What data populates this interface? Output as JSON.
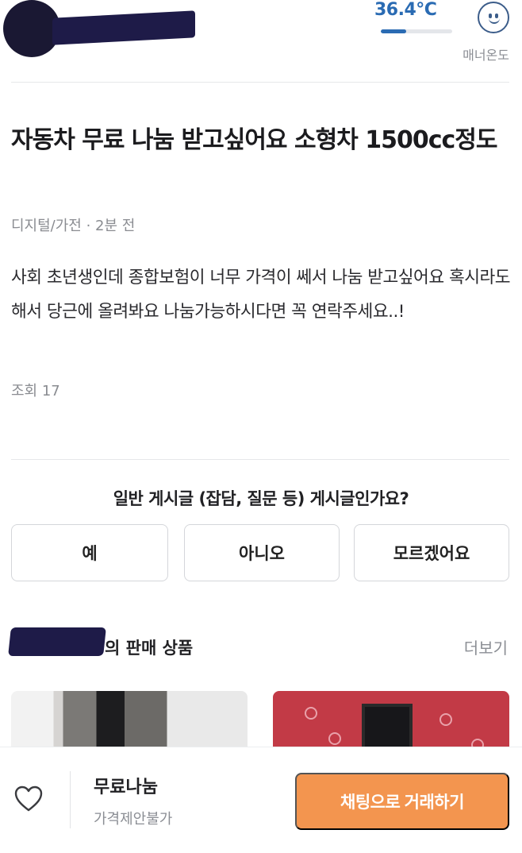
{
  "seller": {
    "manner_temperature": "36.4°C",
    "temperature_level": 0.36,
    "manner_label": "매너온도",
    "face_icon": "smiling-face-icon"
  },
  "post": {
    "title": "자동차 무료 나눔 받고싶어요 소형차 1500cc정도",
    "meta": "디지털/가전 · 2분 전",
    "body": "사회 초년생인데 종합보험이 너무 가격이 쎄서 나눔 받고싶어요 혹시라도 해서 당근에 올려봐요 나눔가능하시다면 꼭 연락주세요..!",
    "views": "조회 17"
  },
  "survey": {
    "question": "일반 게시글 (잡담, 질문 등) 게시글인가요?",
    "answers": [
      "예",
      "아니오",
      "모르겠어요"
    ]
  },
  "seller_products": {
    "heading": "의 판매 상품",
    "more": "더보기"
  },
  "bottom_bar": {
    "heart_icon": "heart-outline-icon",
    "price": "무료나눔",
    "price_note": "가격제안불가",
    "chat_button": "채팅으로 거래하기"
  },
  "colors": {
    "accent": "#f3954f",
    "temperature": "#2a6bb3",
    "redaction": "#1e1b48"
  }
}
